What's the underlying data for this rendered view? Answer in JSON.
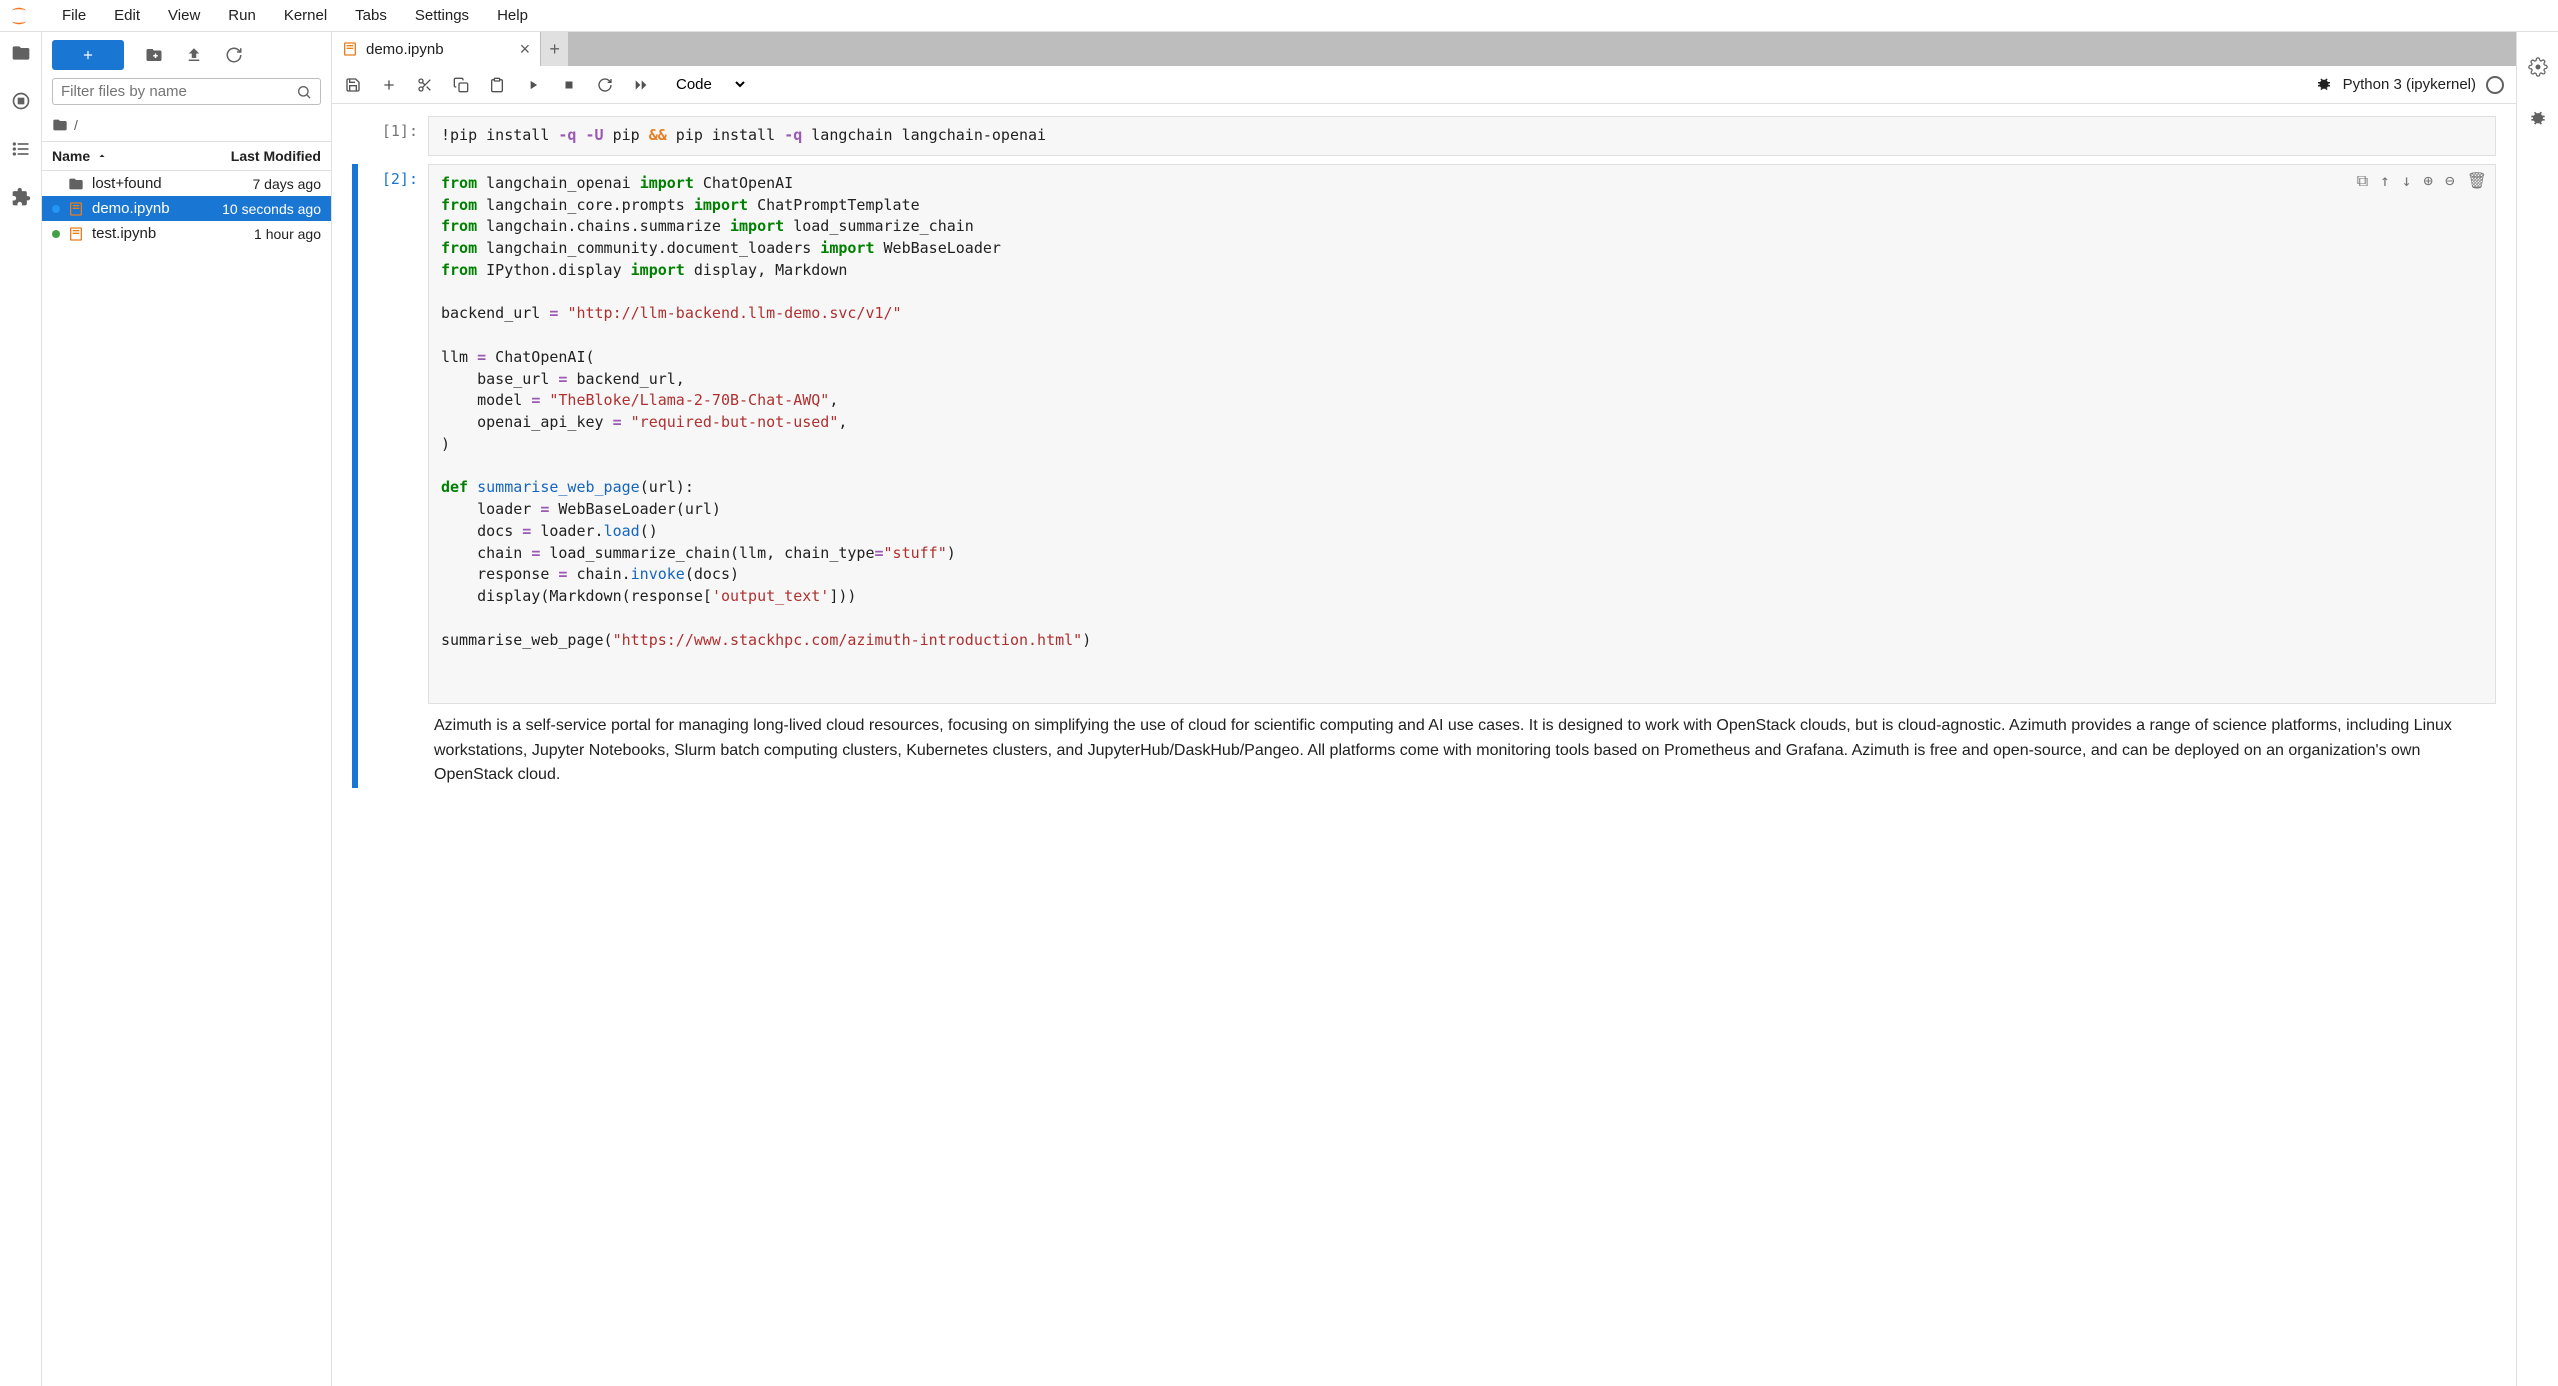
{
  "menubar": {
    "items": [
      "File",
      "Edit",
      "View",
      "Run",
      "Kernel",
      "Tabs",
      "Settings",
      "Help"
    ]
  },
  "fileToolbar": {
    "filterPlaceholder": "Filter files by name",
    "breadcrumb": "/"
  },
  "fileHeader": {
    "name": "Name",
    "modified": "Last Modified"
  },
  "files": [
    {
      "icon": "folder",
      "name": "lost+found",
      "modified": "7 days ago",
      "selected": false,
      "status": "none"
    },
    {
      "icon": "notebook",
      "name": "demo.ipynb",
      "modified": "10 seconds ago",
      "selected": true,
      "status": "blue"
    },
    {
      "icon": "notebook",
      "name": "test.ipynb",
      "modified": "1 hour ago",
      "selected": false,
      "status": "green"
    }
  ],
  "tab": {
    "label": "demo.ipynb"
  },
  "toolbar": {
    "cellType": "Code",
    "kernel": "Python 3 (ipykernel)"
  },
  "cells": {
    "c1": {
      "prompt": "[1]:"
    },
    "c2": {
      "prompt": "[2]:"
    },
    "output": "Azimuth is a self-service portal for managing long-lived cloud resources, focusing on simplifying the use of cloud for scientific computing and AI use cases. It is designed to work with OpenStack clouds, but is cloud-agnostic. Azimuth provides a range of science platforms, including Linux workstations, Jupyter Notebooks, Slurm batch computing clusters, Kubernetes clusters, and JupyterHub/DaskHub/Pangeo. All platforms come with monitoring tools based on Prometheus and Grafana. Azimuth is free and open-source, and can be deployed on an organization's own OpenStack cloud."
  },
  "code1_tokens": [
    {
      "t": "!pip install "
    },
    {
      "t": "-q -U",
      "c": "tk-op"
    },
    {
      "t": " pip "
    },
    {
      "t": "&&",
      "c": "tk-op2"
    },
    {
      "t": " pip install "
    },
    {
      "t": "-q",
      "c": "tk-op"
    },
    {
      "t": " langchain langchain-openai"
    }
  ],
  "code2_tokens": [
    {
      "t": "from",
      "c": "tk-kw"
    },
    {
      "t": " langchain_openai "
    },
    {
      "t": "import",
      "c": "tk-kw"
    },
    {
      "t": " ChatOpenAI\n"
    },
    {
      "t": "from",
      "c": "tk-kw"
    },
    {
      "t": " langchain_core.prompts "
    },
    {
      "t": "import",
      "c": "tk-kw"
    },
    {
      "t": " ChatPromptTemplate\n"
    },
    {
      "t": "from",
      "c": "tk-kw"
    },
    {
      "t": " langchain.chains.summarize "
    },
    {
      "t": "import",
      "c": "tk-kw"
    },
    {
      "t": " load_summarize_chain\n"
    },
    {
      "t": "from",
      "c": "tk-kw"
    },
    {
      "t": " langchain_community.document_loaders "
    },
    {
      "t": "import",
      "c": "tk-kw"
    },
    {
      "t": " WebBaseLoader\n"
    },
    {
      "t": "from",
      "c": "tk-kw"
    },
    {
      "t": " IPython.display "
    },
    {
      "t": "import",
      "c": "tk-kw"
    },
    {
      "t": " display, Markdown\n\n"
    },
    {
      "t": "backend_url "
    },
    {
      "t": "=",
      "c": "tk-op"
    },
    {
      "t": " "
    },
    {
      "t": "\"http://llm-backend.llm-demo.svc/v1/\"",
      "c": "tk-str"
    },
    {
      "t": "\n\n"
    },
    {
      "t": "llm "
    },
    {
      "t": "=",
      "c": "tk-op"
    },
    {
      "t": " ChatOpenAI(\n"
    },
    {
      "t": "    base_url "
    },
    {
      "t": "=",
      "c": "tk-op"
    },
    {
      "t": " backend_url,\n"
    },
    {
      "t": "    model "
    },
    {
      "t": "=",
      "c": "tk-op"
    },
    {
      "t": " "
    },
    {
      "t": "\"TheBloke/Llama-2-70B-Chat-AWQ\"",
      "c": "tk-str"
    },
    {
      "t": ",\n"
    },
    {
      "t": "    openai_api_key "
    },
    {
      "t": "=",
      "c": "tk-op"
    },
    {
      "t": " "
    },
    {
      "t": "\"required-but-not-used\"",
      "c": "tk-str"
    },
    {
      "t": ",\n"
    },
    {
      "t": ")\n\n"
    },
    {
      "t": "def",
      "c": "tk-kw"
    },
    {
      "t": " "
    },
    {
      "t": "summarise_web_page",
      "c": "tk-fn"
    },
    {
      "t": "(url):\n"
    },
    {
      "t": "    loader "
    },
    {
      "t": "=",
      "c": "tk-op"
    },
    {
      "t": " WebBaseLoader(url)\n"
    },
    {
      "t": "    docs "
    },
    {
      "t": "=",
      "c": "tk-op"
    },
    {
      "t": " loader."
    },
    {
      "t": "load",
      "c": "tk-fn"
    },
    {
      "t": "()\n"
    },
    {
      "t": "    chain "
    },
    {
      "t": "=",
      "c": "tk-op"
    },
    {
      "t": " load_summarize_chain(llm, chain_type"
    },
    {
      "t": "=",
      "c": "tk-op"
    },
    {
      "t": "\"stuff\"",
      "c": "tk-str"
    },
    {
      "t": ")\n"
    },
    {
      "t": "    response "
    },
    {
      "t": "=",
      "c": "tk-op"
    },
    {
      "t": " chain."
    },
    {
      "t": "invoke",
      "c": "tk-fn"
    },
    {
      "t": "(docs)\n"
    },
    {
      "t": "    display(Markdown(response["
    },
    {
      "t": "'output_text'",
      "c": "tk-str"
    },
    {
      "t": "]))\n\n"
    },
    {
      "t": "summarise_web_page("
    },
    {
      "t": "\"https://www.stackhpc.com/azimuth-introduction.html\"",
      "c": "tk-str"
    },
    {
      "t": ")"
    }
  ]
}
